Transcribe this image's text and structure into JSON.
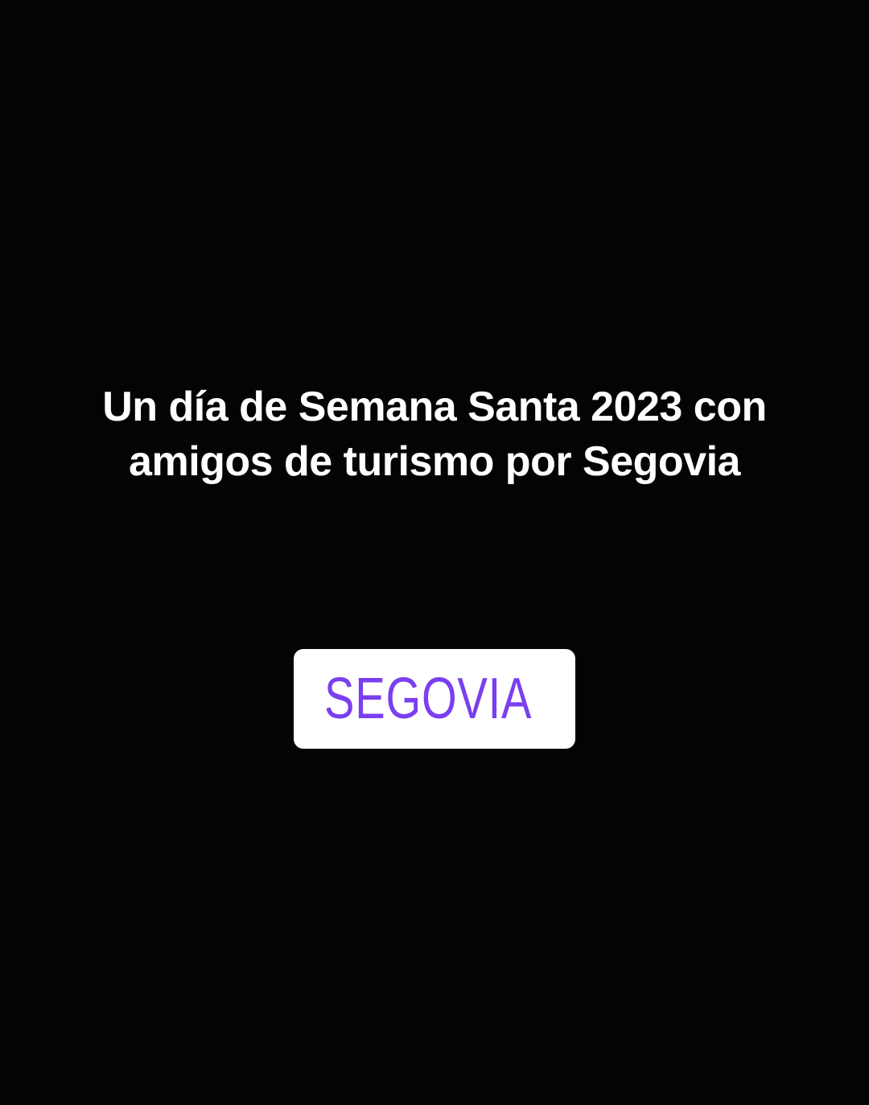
{
  "story": {
    "caption_lines": [
      "Un día de Semana Santa 2023 con",
      "amigos de turismo por Segovia"
    ]
  },
  "location_sticker": {
    "label": "SEGOVIA",
    "icon": "map-pin-icon",
    "accent_color": "#7a3ff0"
  }
}
